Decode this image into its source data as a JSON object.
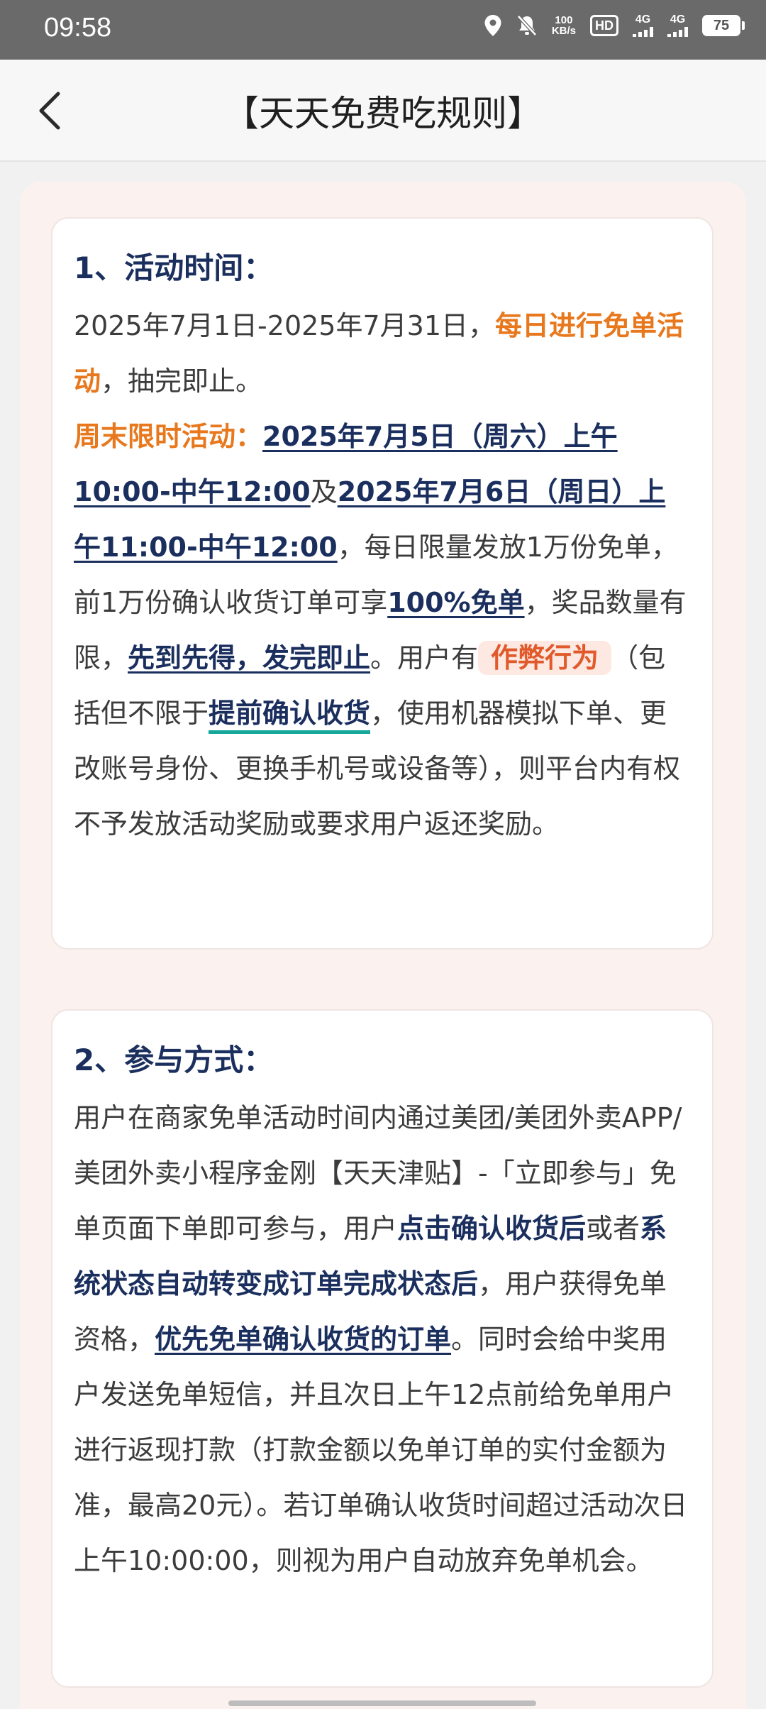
{
  "status_bar": {
    "time": "09:58",
    "speed_value": "100",
    "speed_unit": "KB/s",
    "hd_label": "HD",
    "sim1_label": "4G",
    "sim2_label": "4G",
    "battery": "75"
  },
  "header": {
    "title": "【天天免费吃规则】"
  },
  "section1": {
    "heading": "1、活动时间：",
    "p1_a": "2025年7月1日-2025年7月31日，",
    "p1_b": "每日进行免单活动",
    "p1_c": "，抽完即止。",
    "p2_a": "周末限时活动：",
    "p2_b": "2025年7月5日（周六）上午10:00-中午12:00",
    "p2_c": "及",
    "p2_d": "2025年7月6日（周日）上午11:00-中午12:00",
    "p2_e": "，每日限量发放1万份免单，前1万份确认收货订单可享",
    "p2_f": "100%免单",
    "p2_g": "，奖品数量有限，",
    "p2_h": "先到先得，发完即止",
    "p2_i": "。用户有",
    "p2_j": "作弊行为",
    "p2_k": "（包括但不限于",
    "p2_l": "提前确认收货",
    "p2_m": "，使用机器模拟下单、更改账号身份、更换手机号或设备等），则平台内有权不予发放活动奖励或要求用户返还奖励。"
  },
  "section2": {
    "heading": "2、参与方式：",
    "p_a": "用户在商家免单活动时间内通过美团/美团外卖APP/美团外卖小程序金刚【天天津贴】-「立即参与」免单页面下单即可参与，用户",
    "p_b": "点击确认收货后",
    "p_c": "或者",
    "p_d": "系统状态自动转变成订单完成状态后",
    "p_e": "，用户获得免单资格，",
    "p_f": "优先免单确认收货的订单",
    "p_g": "。同时会给中奖用户发送免单短信，并且次日上午12点前给免单用户进行返现打款（打款金额以免单订单的实付金额为准，最高20元）。若订单确认收货时间超过活动次日上午10:00:00，则视为用户自动放弃免单机会。"
  }
}
